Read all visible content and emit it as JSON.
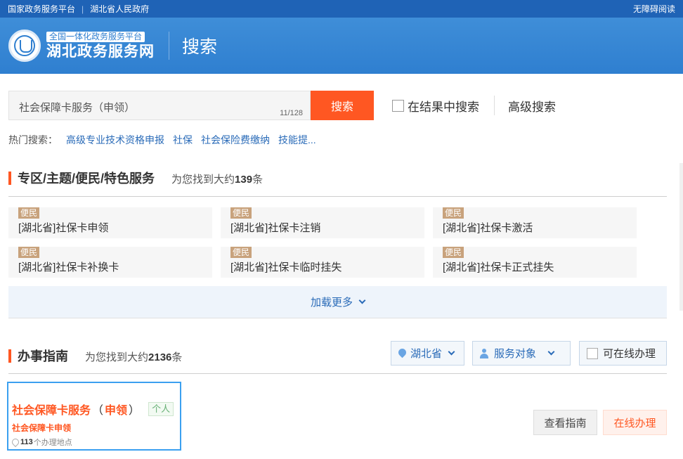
{
  "topbar": {
    "link1": "国家政务服务平台",
    "link2": "湖北省人民政府",
    "accessible": "无障碍阅读"
  },
  "header": {
    "logo_sub": "全国一体化政务服务平台",
    "logo_main": "湖北政务服务网",
    "page_title": "搜索"
  },
  "search": {
    "value": "社会保障卡服务（申领）",
    "count": "11/128",
    "button": "搜索",
    "within_label": "在结果中搜索",
    "advanced": "高级搜索"
  },
  "hot": {
    "label": "热门搜索：",
    "items": [
      "高级专业技术资格申报",
      "社保",
      "社会保险费缴纳",
      "技能提..."
    ]
  },
  "section1": {
    "title": "专区/主题/便民/特色服务",
    "count_prefix": "为您找到大约",
    "count": "139",
    "count_suffix": "条",
    "cards": [
      {
        "tag": "便民",
        "text": "[湖北省]社保卡申领"
      },
      {
        "tag": "便民",
        "text": "[湖北省]社保卡注销"
      },
      {
        "tag": "便民",
        "text": "[湖北省]社保卡激活"
      },
      {
        "tag": "便民",
        "text": "[湖北省]社保卡补换卡"
      },
      {
        "tag": "便民",
        "text": "[湖北省]社保卡临时挂失"
      },
      {
        "tag": "便民",
        "text": "[湖北省]社保卡正式挂失"
      }
    ],
    "load_more": "加载更多"
  },
  "section2": {
    "title": "办事指南",
    "count_prefix": "为您找到大约",
    "count": "2136",
    "count_suffix": "条",
    "filter_region": "湖北省",
    "filter_target": "服务对象",
    "filter_online": "可在线办理"
  },
  "result": {
    "title_main": "社会保障卡服务",
    "paren_open": "（",
    "title_paren": "申领",
    "paren_close": "）",
    "tag": "个人",
    "subtitle": "社会保障卡申领",
    "loc_count": "113",
    "loc_suffix": "个办理地点",
    "btn_guide": "查看指南",
    "btn_online": "在线办理"
  },
  "colors": {
    "primary": "#2f7fd0",
    "accent": "#ff5722",
    "link": "#2a6bb8"
  }
}
